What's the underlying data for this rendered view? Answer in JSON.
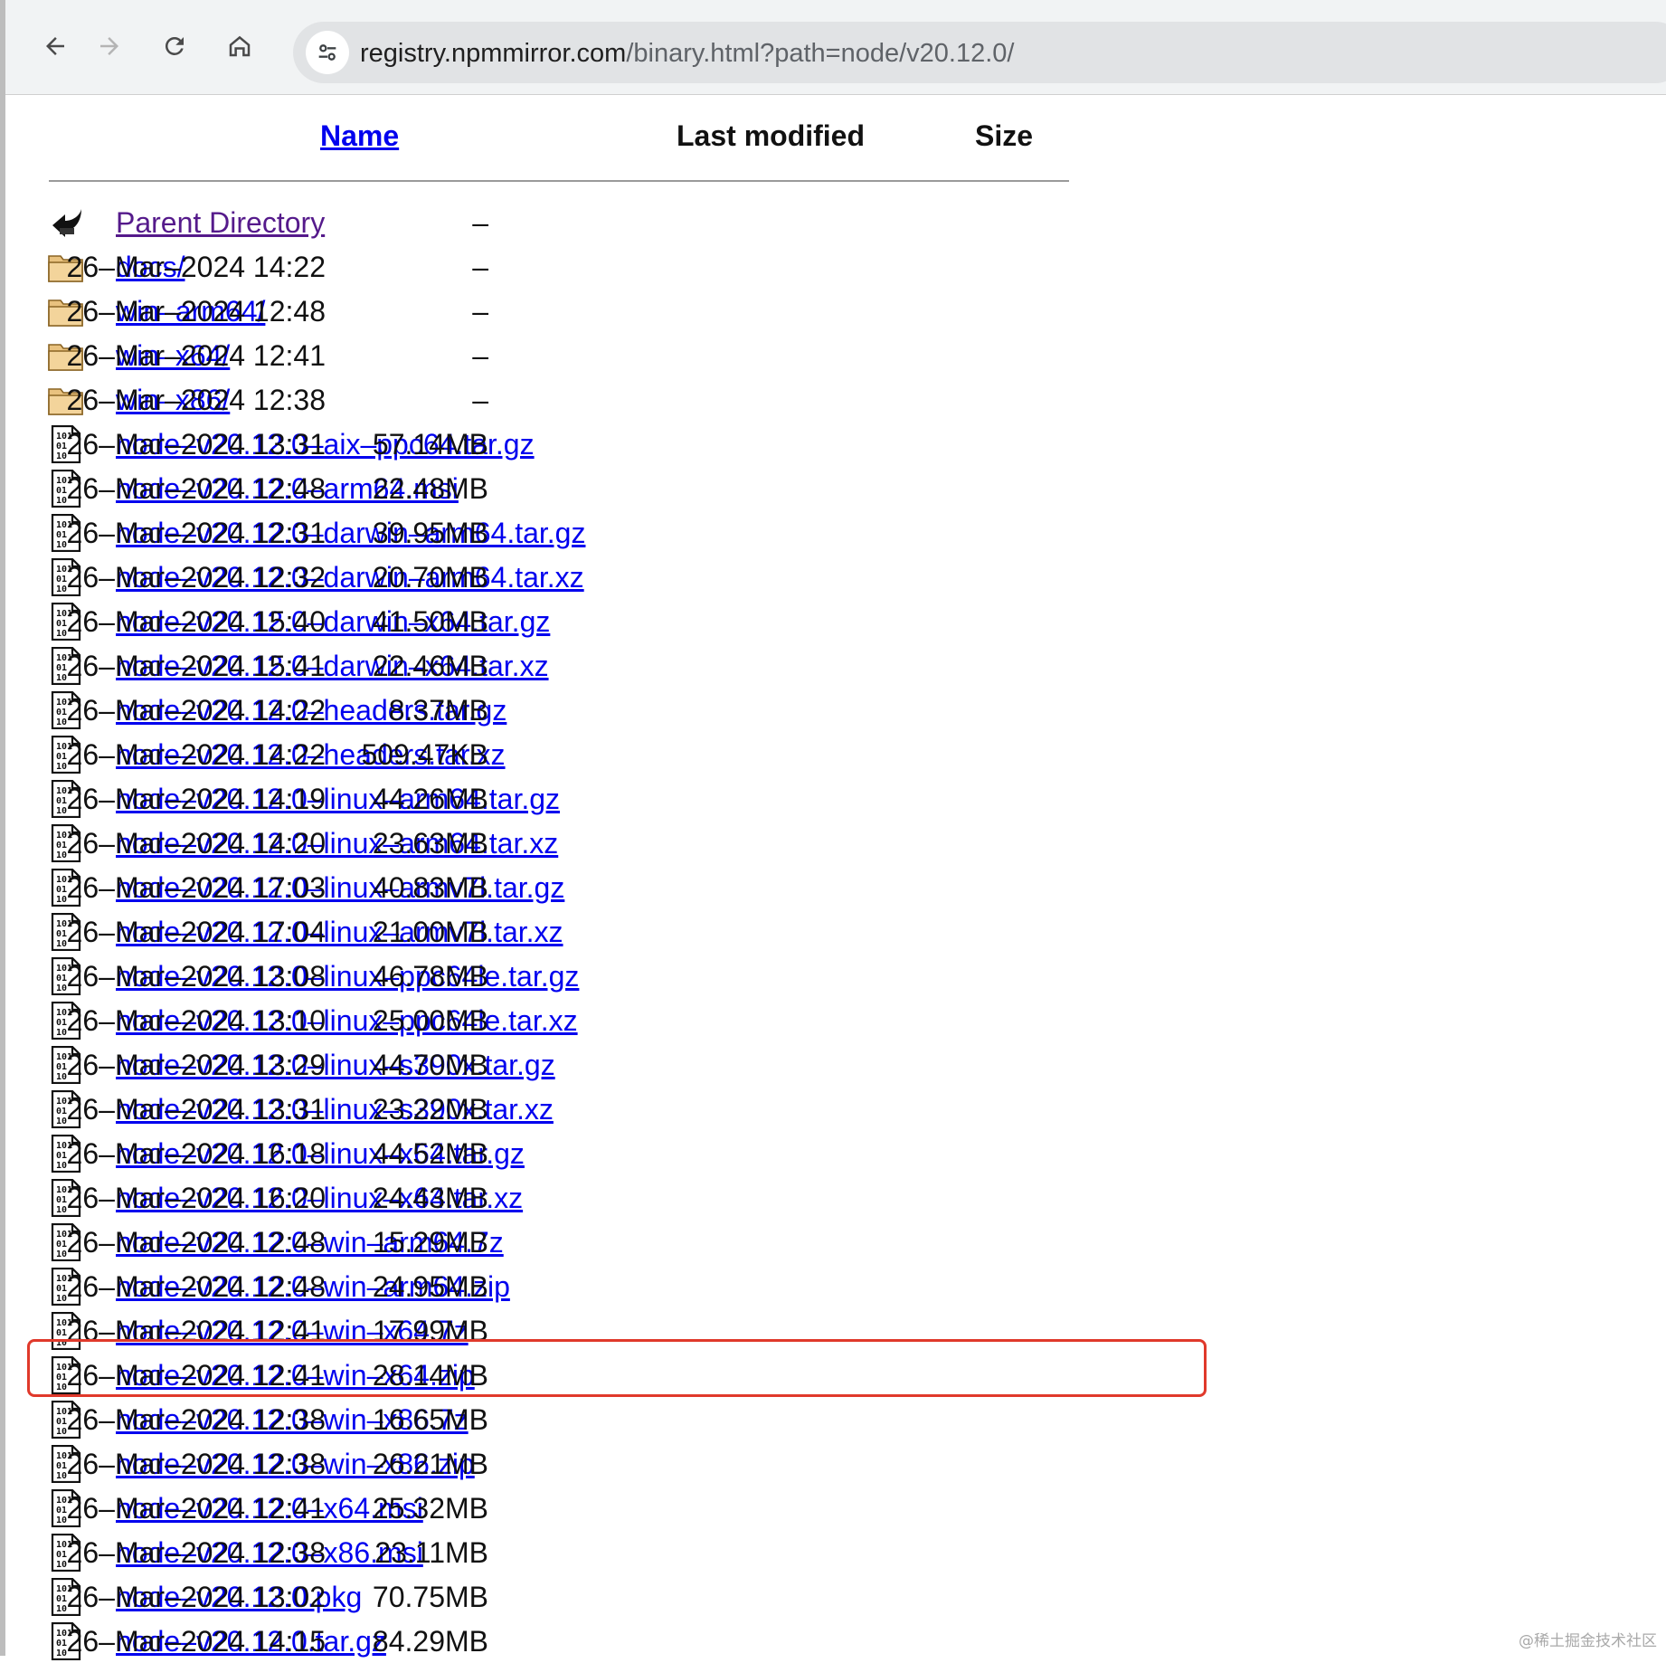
{
  "browser": {
    "url_domain": "registry.npmmirror.com",
    "url_rest": "/binary.html?path=node/v20.12.0/",
    "back_icon": "back-arrow-icon",
    "forward_icon": "forward-arrow-icon",
    "reload_icon": "reload-icon",
    "home_icon": "home-icon",
    "site_info_icon": "tune-icon"
  },
  "table": {
    "headers": {
      "name": "Name",
      "last_modified": "Last modified",
      "size": "Size"
    },
    "rows": [
      {
        "name": "Parent Directory",
        "date": "",
        "size": "–",
        "icon": "back",
        "visited": true
      },
      {
        "name": "docs/",
        "date": "26–Mar–2024 14:22",
        "size": "–",
        "icon": "folder"
      },
      {
        "name": "win–arm64/",
        "date": "26–Mar–2024 12:48",
        "size": "–",
        "icon": "folder"
      },
      {
        "name": "win–x64/",
        "date": "26–Mar–2024 12:41",
        "size": "–",
        "icon": "folder"
      },
      {
        "name": "win–x86/",
        "date": "26–Mar–2024 12:38",
        "size": "–",
        "icon": "folder"
      },
      {
        "name": "node–v20.12.0–aix–ppc64.tar.gz",
        "date": "26–Mar–2024 13:31",
        "size": "57.14MB",
        "icon": "binary"
      },
      {
        "name": "node–v20.12.0–arm64.msi",
        "date": "26–Mar–2024 12:48",
        "size": "22.48MB",
        "icon": "binary"
      },
      {
        "name": "node–v20.12.0–darwin–arm64.tar.gz",
        "date": "26–Mar–2024 12:31",
        "size": "39.95MB",
        "icon": "binary"
      },
      {
        "name": "node–v20.12.0–darwin–arm64.tar.xz",
        "date": "26–Mar–2024 12:32",
        "size": "20.70MB",
        "icon": "binary"
      },
      {
        "name": "node–v20.12.0–darwin–x64.tar.gz",
        "date": "26–Mar–2024 15:40",
        "size": "41.50MB",
        "icon": "binary"
      },
      {
        "name": "node–v20.12.0–darwin–x64.tar.xz",
        "date": "26–Mar–2024 15:41",
        "size": "22.46MB",
        "icon": "binary"
      },
      {
        "name": "node–v20.12.0–headers.tar.gz",
        "date": "26–Mar–2024 14:22",
        "size": "8.37MB",
        "icon": "binary"
      },
      {
        "name": "node–v20.12.0–headers.tar.xz",
        "date": "26–Mar–2024 14:22",
        "size": "509.47KB",
        "icon": "binary"
      },
      {
        "name": "node–v20.12.0–linux–arm64.tar.gz",
        "date": "26–Mar–2024 14:19",
        "size": "44.26MB",
        "icon": "binary"
      },
      {
        "name": "node–v20.12.0–linux–arm64.tar.xz",
        "date": "26–Mar–2024 14:20",
        "size": "23.63MB",
        "icon": "binary"
      },
      {
        "name": "node–v20.12.0–linux–armv7l.tar.gz",
        "date": "26–Mar–2024 17:03",
        "size": "40.83MB",
        "icon": "binary"
      },
      {
        "name": "node–v20.12.0–linux–armv7l.tar.xz",
        "date": "26–Mar–2024 17:04",
        "size": "21.00MB",
        "icon": "binary"
      },
      {
        "name": "node–v20.12.0–linux–ppc64le.tar.gz",
        "date": "26–Mar–2024 13:08",
        "size": "46.78MB",
        "icon": "binary"
      },
      {
        "name": "node–v20.12.0–linux–ppc64le.tar.xz",
        "date": "26–Mar–2024 13:10",
        "size": "25.00MB",
        "icon": "binary"
      },
      {
        "name": "node–v20.12.0–linux–s390x.tar.gz",
        "date": "26–Mar–2024 13:29",
        "size": "44.70MB",
        "icon": "binary"
      },
      {
        "name": "node–v20.12.0–linux–s390x.tar.xz",
        "date": "26–Mar–2024 13:31",
        "size": "23.22MB",
        "icon": "binary"
      },
      {
        "name": "node–v20.12.0–linux–x64.tar.gz",
        "date": "26–Mar–2024 16:18",
        "size": "44.52MB",
        "icon": "binary"
      },
      {
        "name": "node–v20.12.0–linux–x64.tar.xz",
        "date": "26–Mar–2024 16:20",
        "size": "24.43MB",
        "icon": "binary"
      },
      {
        "name": "node–v20.12.0–win–arm64.7z",
        "date": "26–Mar–2024 12:48",
        "size": "15.29MB",
        "icon": "binary"
      },
      {
        "name": "node–v20.12.0–win–arm64.zip",
        "date": "26–Mar–2024 12:48",
        "size": "24.95MB",
        "icon": "binary"
      },
      {
        "name": "node–v20.12.0–win–x64.7z",
        "date": "26–Mar–2024 12:41",
        "size": "17.99MB",
        "icon": "binary"
      },
      {
        "name": "node–v20.12.0–win–x64.zip",
        "date": "26–Mar–2024 12:41",
        "size": "28.14MB",
        "icon": "binary",
        "highlighted": true
      },
      {
        "name": "node–v20.12.0–win–x86.7z",
        "date": "26–Mar–2024 12:38",
        "size": "16.65MB",
        "icon": "binary"
      },
      {
        "name": "node–v20.12.0–win–x86.zip",
        "date": "26–Mar–2024 12:38",
        "size": "26.21MB",
        "icon": "binary"
      },
      {
        "name": "node–v20.12.0–x64.msi",
        "date": "26–Mar–2024 12:41",
        "size": "25.32MB",
        "icon": "binary"
      },
      {
        "name": "node–v20.12.0–x86.msi",
        "date": "26–Mar–2024 12:38",
        "size": "23.11MB",
        "icon": "binary"
      },
      {
        "name": "node–v20.12.0.pkg",
        "date": "26–Mar–2024 13:02",
        "size": "70.75MB",
        "icon": "binary"
      },
      {
        "name": "node–v20.12.0.tar.gz",
        "date": "26–Mar–2024 14:15",
        "size": "84.29MB",
        "icon": "binary"
      }
    ]
  },
  "highlight_color": "#e0392b",
  "link_color": "#0000ee",
  "visited_color": "#551a8b",
  "watermark": "@稀土掘金技术社区"
}
